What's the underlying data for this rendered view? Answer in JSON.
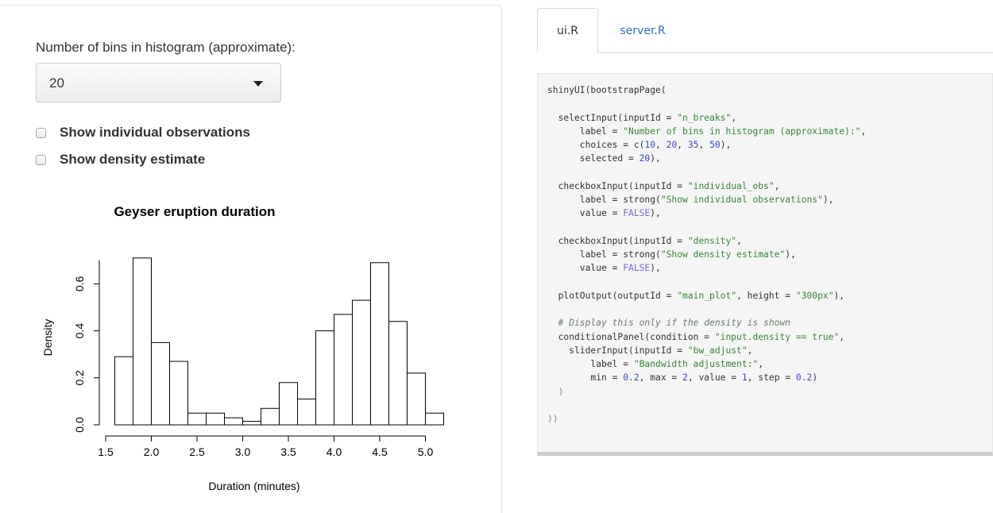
{
  "controls": {
    "select_label": "Number of bins in histogram (approximate):",
    "select_value": "20",
    "checkbox_individual": {
      "label": "Show individual observations",
      "checked": false
    },
    "checkbox_density": {
      "label": "Show density estimate",
      "checked": false
    }
  },
  "chart_data": {
    "type": "bar",
    "title": "Geyser eruption duration",
    "xlabel": "Duration (minutes)",
    "ylabel": "Density",
    "bin_width": 0.2,
    "bin_starts": [
      1.6,
      1.8,
      2.0,
      2.2,
      2.4,
      2.6,
      2.8,
      3.0,
      3.2,
      3.4,
      3.6,
      3.8,
      4.0,
      4.2,
      4.4,
      4.6,
      4.8,
      5.0
    ],
    "values": [
      0.29,
      0.71,
      0.35,
      0.27,
      0.05,
      0.05,
      0.03,
      0.015,
      0.07,
      0.18,
      0.11,
      0.4,
      0.47,
      0.53,
      0.69,
      0.44,
      0.22,
      0.05
    ],
    "xlim": [
      1.5,
      5.2
    ],
    "ylim": [
      0.0,
      0.7
    ],
    "xticks": [
      "1.5",
      "2.0",
      "2.5",
      "3.0",
      "3.5",
      "4.0",
      "4.5",
      "5.0"
    ],
    "yticks": [
      "0.0",
      "0.2",
      "0.4",
      "0.6"
    ],
    "grid": false,
    "bar_color": "#ffffff",
    "edge_color": "#000000"
  },
  "tabs": [
    {
      "label": "ui.R",
      "active": true
    },
    {
      "label": "server.R",
      "active": false
    }
  ],
  "code": {
    "lines": [
      [
        [
          "p",
          "shinyUI(bootstrapPage("
        ]
      ],
      [],
      [
        [
          "p",
          "  selectInput(inputId = "
        ],
        [
          "s",
          "\"n_breaks\""
        ],
        [
          "p",
          ","
        ]
      ],
      [
        [
          "p",
          "      label = "
        ],
        [
          "s",
          "\"Number of bins in histogram (approximate):\""
        ],
        [
          "p",
          ","
        ]
      ],
      [
        [
          "p",
          "      choices = c("
        ],
        [
          "n",
          "10"
        ],
        [
          "p",
          ", "
        ],
        [
          "n",
          "20"
        ],
        [
          "p",
          ", "
        ],
        [
          "n",
          "35"
        ],
        [
          "p",
          ", "
        ],
        [
          "n",
          "50"
        ],
        [
          "p",
          "),"
        ]
      ],
      [
        [
          "p",
          "      selected = "
        ],
        [
          "n",
          "20"
        ],
        [
          "p",
          "),"
        ]
      ],
      [],
      [
        [
          "p",
          "  checkboxInput(inputId = "
        ],
        [
          "s",
          "\"individual_obs\""
        ],
        [
          "p",
          ","
        ]
      ],
      [
        [
          "p",
          "      label = strong("
        ],
        [
          "s",
          "\"Show individual observations\""
        ],
        [
          "p",
          "),"
        ]
      ],
      [
        [
          "p",
          "      value = "
        ],
        [
          "k",
          "FALSE"
        ],
        [
          "p",
          "),"
        ]
      ],
      [],
      [
        [
          "p",
          "  checkboxInput(inputId = "
        ],
        [
          "s",
          "\"density\""
        ],
        [
          "p",
          ","
        ]
      ],
      [
        [
          "p",
          "      label = strong("
        ],
        [
          "s",
          "\"Show density estimate\""
        ],
        [
          "p",
          "),"
        ]
      ],
      [
        [
          "p",
          "      value = "
        ],
        [
          "k",
          "FALSE"
        ],
        [
          "p",
          "),"
        ]
      ],
      [],
      [
        [
          "p",
          "  plotOutput(outputId = "
        ],
        [
          "s",
          "\"main_plot\""
        ],
        [
          "p",
          ", height = "
        ],
        [
          "s",
          "\"300px\""
        ],
        [
          "p",
          "),"
        ]
      ],
      [],
      [
        [
          "c",
          "  # Display this only if the density is shown"
        ]
      ],
      [
        [
          "p",
          "  conditionalPanel(condition = "
        ],
        [
          "s",
          "\"input.density == true\""
        ],
        [
          "p",
          ","
        ]
      ],
      [
        [
          "p",
          "    sliderInput(inputId = "
        ],
        [
          "s",
          "\"bw_adjust\""
        ],
        [
          "p",
          ","
        ]
      ],
      [
        [
          "p",
          "        label = "
        ],
        [
          "s",
          "\"Bandwidth adjustment:\""
        ],
        [
          "p",
          ","
        ]
      ],
      [
        [
          "p",
          "        min = "
        ],
        [
          "n",
          "0.2"
        ],
        [
          "p",
          ", max = "
        ],
        [
          "n",
          "2"
        ],
        [
          "p",
          ", value = "
        ],
        [
          "n",
          "1"
        ],
        [
          "p",
          ", step = "
        ],
        [
          "n",
          "0.2"
        ],
        [
          "p",
          ")"
        ]
      ],
      [
        [
          "g",
          "  )"
        ]
      ],
      [],
      [
        [
          "g",
          "))"
        ]
      ]
    ]
  }
}
